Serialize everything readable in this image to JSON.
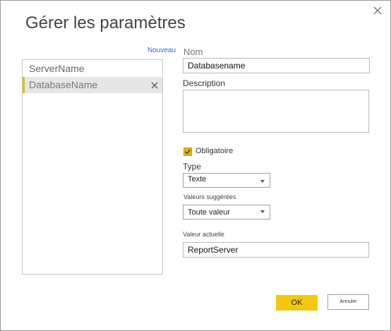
{
  "dialog": {
    "title": "Gérer les paramètres",
    "close_icon": "close-icon",
    "new_link": "Nouveau"
  },
  "parameters": {
    "items": [
      {
        "label": "ServerName",
        "selected": false
      },
      {
        "label": "DatabaseName",
        "selected": true,
        "remove_icon": "close-icon"
      }
    ]
  },
  "form": {
    "name_label": "Nom",
    "name_value": "Databasename",
    "description_label": "Description",
    "description_value": "",
    "required_label": "Obligatoire",
    "required_checked": true,
    "type_label": "Type",
    "type_value": "Texte",
    "suggested_label": "Valeurs suggérées",
    "suggested_value": "Toute valeur",
    "current_label": "Valeur actuelle",
    "current_value": "ReportServer"
  },
  "buttons": {
    "ok_label": "OK",
    "cancel_label": "Annuler"
  },
  "colors": {
    "accent": "#f2c811",
    "link": "#2f6fbf",
    "selected_bg": "#e6e6e6"
  }
}
